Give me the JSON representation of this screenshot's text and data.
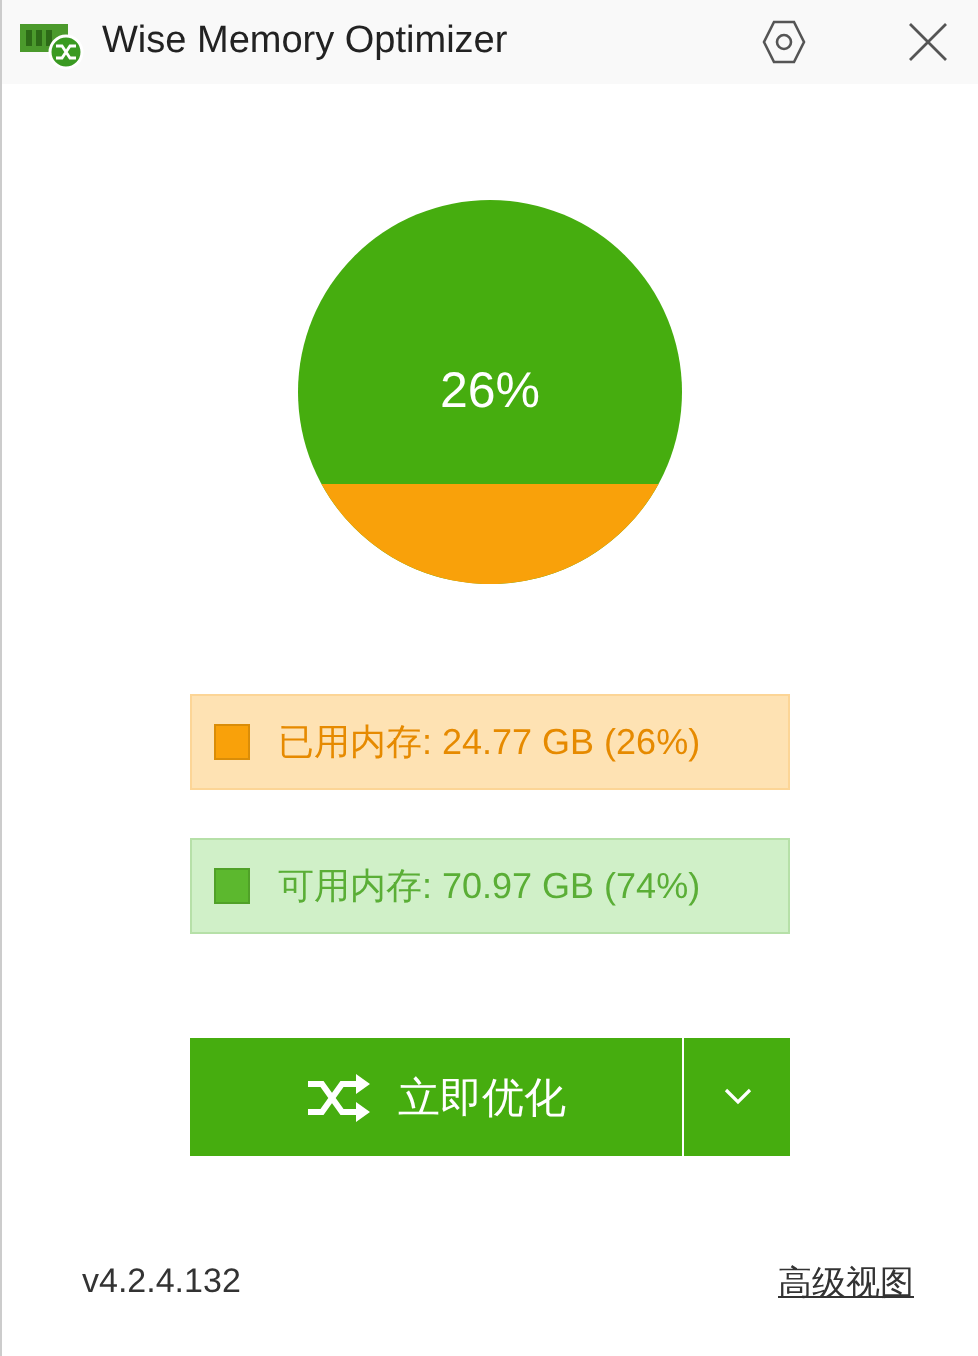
{
  "window": {
    "title": "Wise Memory Optimizer"
  },
  "gauge": {
    "label": "26%"
  },
  "legend": [
    {
      "label": "已用内存: 24.77 GB (26%)",
      "color": "#f9a10a",
      "kind": "used"
    },
    {
      "label": "可用内存: 70.97 GB (74%)",
      "color": "#5cb82e",
      "kind": "free"
    }
  ],
  "optimize_button": {
    "label": "立即优化"
  },
  "footer": {
    "version": "v4.2.4.132",
    "link": "高级视图"
  }
}
